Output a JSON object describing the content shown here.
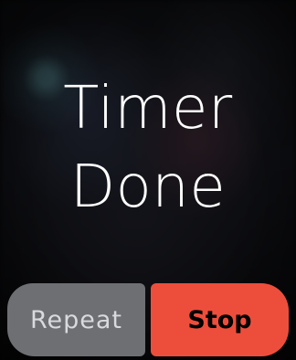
{
  "alert": {
    "line1": "Timer",
    "line2": "Done"
  },
  "actions": {
    "repeat_label": "Repeat",
    "stop_label": "Stop"
  },
  "colors": {
    "stop_button": "#ed4e3b",
    "repeat_button": "#6d6f73"
  }
}
